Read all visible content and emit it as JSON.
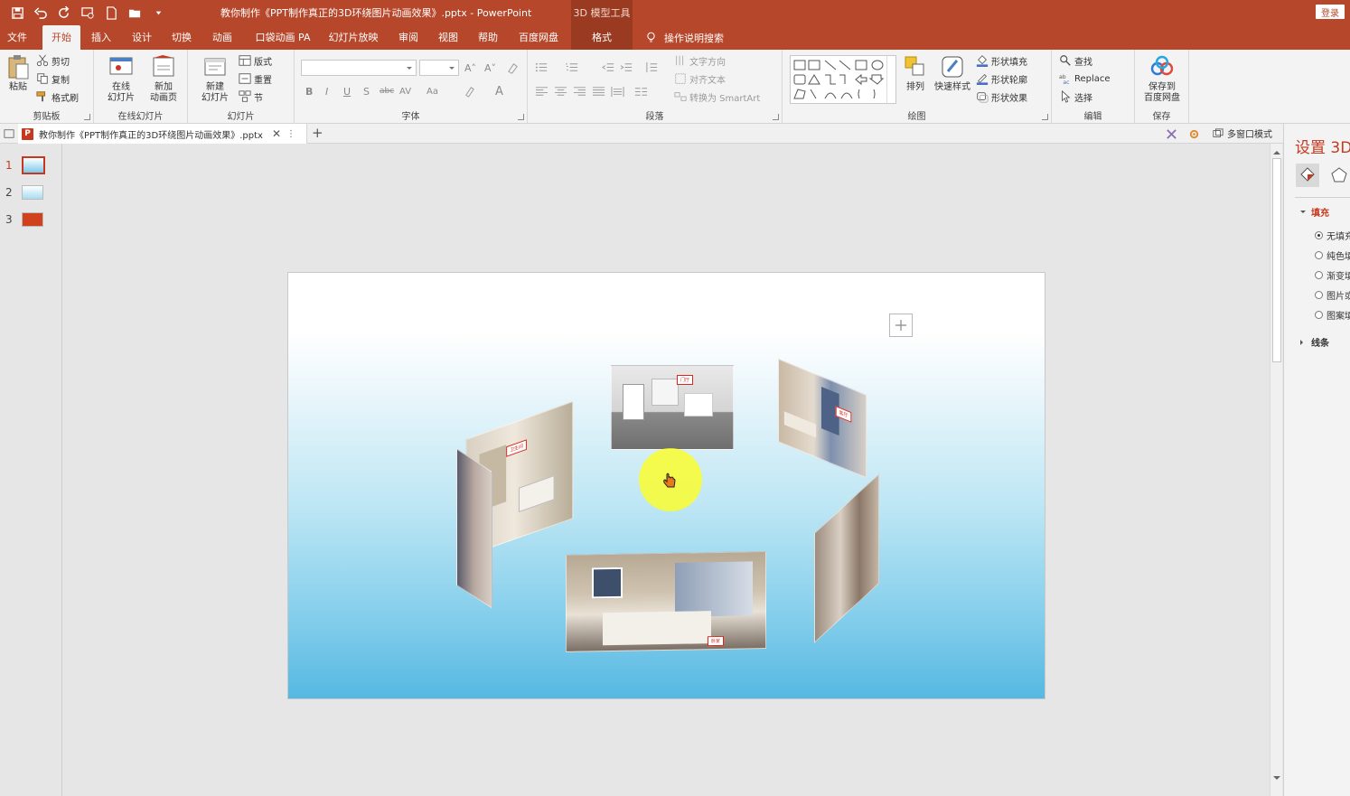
{
  "title_bar": {
    "document_title": "教你制作《PPT制作真正的3D环绕图片动画效果》.pptx  -  PowerPoint",
    "context_title": "3D 模型工具",
    "login_label": "登录"
  },
  "tabs": [
    {
      "label": "文件"
    },
    {
      "label": "开始"
    },
    {
      "label": "插入"
    },
    {
      "label": "设计"
    },
    {
      "label": "切换"
    },
    {
      "label": "动画"
    },
    {
      "label": "口袋动画 PA"
    },
    {
      "label": "幻灯片放映"
    },
    {
      "label": "审阅"
    },
    {
      "label": "视图"
    },
    {
      "label": "帮助"
    },
    {
      "label": "百度网盘"
    },
    {
      "label": "格式"
    }
  ],
  "tell_me": "操作说明搜索",
  "ribbon": {
    "clipboard": {
      "paste": "粘贴",
      "cut": "剪切",
      "copy": "复制",
      "format_painter": "格式刷",
      "label": "剪贴板"
    },
    "online_slides": {
      "online": "在线\n幻灯片",
      "new_anim": "新加\n动画页",
      "label": "在线幻灯片"
    },
    "slides": {
      "new_slide": "新建\n幻灯片",
      "layout": "版式",
      "reset": "重置",
      "section": "节",
      "label": "幻灯片"
    },
    "font": {
      "bold": "B",
      "italic": "I",
      "underline": "U",
      "shadow": "S",
      "strike": "abc",
      "spacing": "AV",
      "case": "Aa",
      "label": "字体"
    },
    "paragraph": {
      "text_direction": "文字方向",
      "align_text": "对齐文本",
      "smartart": "转换为 SmartArt",
      "label": "段落"
    },
    "drawing": {
      "arrange": "排列",
      "quick_styles": "快速样式",
      "shape_fill": "形状填充",
      "shape_outline": "形状轮廓",
      "shape_effects": "形状效果",
      "label": "绘图"
    },
    "editing": {
      "find": "查找",
      "replace": "Replace",
      "select": "选择",
      "label": "编辑"
    },
    "save": {
      "save_baidu": "保存到\n百度网盘",
      "label": "保存"
    }
  },
  "doc_tab": {
    "name": "教你制作《PPT制作真正的3D环绕图片动画效果》.pptx",
    "multi_window": "多窗口模式"
  },
  "thumbnails": [
    {
      "num": "1"
    },
    {
      "num": "2"
    },
    {
      "num": "3"
    }
  ],
  "slide_content": {
    "tags": {
      "bathroom": "卫生间",
      "hall": "门厅",
      "living": "客厅",
      "bedroom": "卧室"
    }
  },
  "format_pane": {
    "title": "设置 3D",
    "fill_section": "填充",
    "fill_options": [
      "无填充",
      "纯色填充",
      "渐变填充",
      "图片或纹理填充",
      "图案填充"
    ],
    "line_section": "线条"
  },
  "colors": {
    "accent": "#b7472a",
    "accent_dark": "#9a3a21",
    "selection": "#c4391f"
  }
}
